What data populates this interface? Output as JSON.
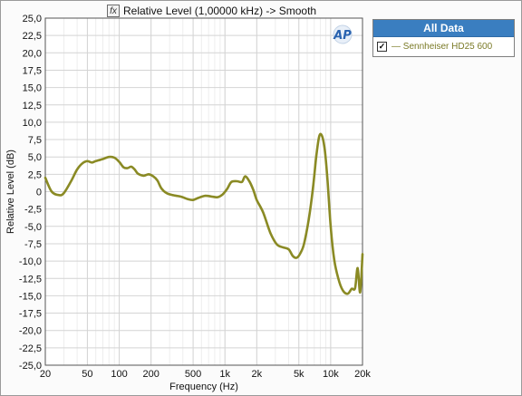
{
  "window": {
    "title": "Relative Level (1,00000 kHz) -> Smooth",
    "title_icon": "fx-icon",
    "logo_text": "AP"
  },
  "legend": {
    "header": "All Data",
    "checked": true,
    "item_label": "— Sennheiser HD25 600"
  },
  "chart_data": {
    "type": "line",
    "title": "Relative Level (1,00000 kHz) -> Smooth",
    "xlabel": "Frequency (Hz)",
    "ylabel": "Relative Level (dB)",
    "xscale": "log",
    "xlim": [
      20,
      20000
    ],
    "ylim": [
      -25,
      25
    ],
    "grid": true,
    "legend_position": "outside-top-right",
    "x_ticks": [
      20,
      50,
      100,
      200,
      500,
      1000,
      2000,
      5000,
      10000,
      20000
    ],
    "x_tick_labels": [
      "20",
      "50",
      "100",
      "200",
      "500",
      "1k",
      "2k",
      "5k",
      "10k",
      "20k"
    ],
    "y_ticks": [
      25,
      22.5,
      20,
      17.5,
      15,
      12.5,
      10,
      7.5,
      5,
      2.5,
      0,
      -2.5,
      -5,
      -7.5,
      -10,
      -12.5,
      -15,
      -17.5,
      -20,
      -22.5,
      -25
    ],
    "y_tick_labels": [
      "25,0",
      "22,5",
      "20,0",
      "17,5",
      "15,0",
      "12,5",
      "10,0",
      "7,5",
      "5,0",
      "2,5",
      "0",
      "-2,5",
      "-5,0",
      "-7,5",
      "-10,0",
      "-12,5",
      "-15,0",
      "-17,5",
      "-20,0",
      "-22,5",
      "-25,0"
    ],
    "series": [
      {
        "name": "Sennheiser HD25 600",
        "color": "#8a8a24",
        "x": [
          20,
          23,
          27,
          30,
          35,
          40,
          45,
          50,
          55,
          60,
          70,
          80,
          90,
          100,
          110,
          120,
          130,
          140,
          150,
          170,
          190,
          210,
          230,
          250,
          280,
          320,
          380,
          450,
          500,
          560,
          650,
          750,
          850,
          950,
          1050,
          1150,
          1300,
          1450,
          1550,
          1700,
          1850,
          2000,
          2300,
          2700,
          3100,
          3500,
          4000,
          4400,
          4800,
          5200,
          5600,
          6200,
          6800,
          7300,
          7800,
          8300,
          8800,
          9300,
          10000,
          10800,
          11800,
          13000,
          14500,
          15800,
          17000,
          18000,
          19000,
          20000
        ],
        "y": [
          2.0,
          0.0,
          -0.5,
          -0.2,
          1.5,
          3.2,
          4.1,
          4.4,
          4.2,
          4.4,
          4.7,
          5.0,
          4.9,
          4.3,
          3.5,
          3.4,
          3.6,
          3.2,
          2.6,
          2.3,
          2.5,
          2.2,
          1.6,
          0.5,
          -0.2,
          -0.5,
          -0.7,
          -1.1,
          -1.2,
          -0.9,
          -0.6,
          -0.7,
          -0.8,
          -0.4,
          0.4,
          1.4,
          1.5,
          1.4,
          2.2,
          1.5,
          0.3,
          -1.2,
          -3.0,
          -6.0,
          -7.6,
          -8.0,
          -8.3,
          -9.3,
          -9.5,
          -8.8,
          -7.5,
          -4.0,
          0.5,
          5.0,
          8.0,
          8.0,
          6.0,
          2.0,
          -5.0,
          -9.8,
          -12.5,
          -14.2,
          -14.7,
          -14.0,
          -13.9,
          -11.0,
          -14.5,
          -9.0
        ]
      }
    ]
  }
}
